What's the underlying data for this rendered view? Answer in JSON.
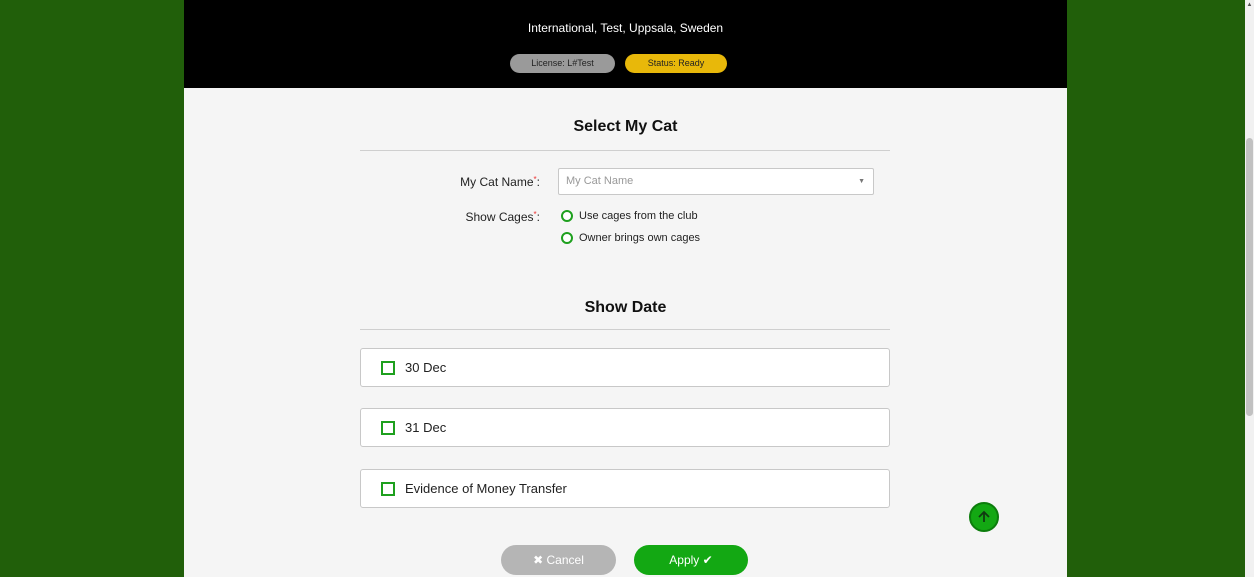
{
  "header": {
    "subtitle": "International, Test, Uppsala, Sweden",
    "license_badge": "License: L#Test",
    "status_badge": "Status: Ready"
  },
  "select_cat": {
    "title": "Select My Cat",
    "cat_name_label": "My Cat Name",
    "cat_name_placeholder": "My Cat Name",
    "required_mark": "*",
    "cages_label": "Show Cages",
    "colon": ":",
    "cage_options": [
      "Use cages from the club",
      "Owner brings own cages"
    ]
  },
  "show_date": {
    "title": "Show Date",
    "options": [
      "30 Dec",
      "31 Dec",
      "Evidence of Money Transfer"
    ]
  },
  "actions": {
    "cancel_label": "Cancel",
    "apply_label": "Apply"
  },
  "colors": {
    "background": "#215f0a",
    "accent": "#13a813",
    "status": "#e8b80a"
  }
}
